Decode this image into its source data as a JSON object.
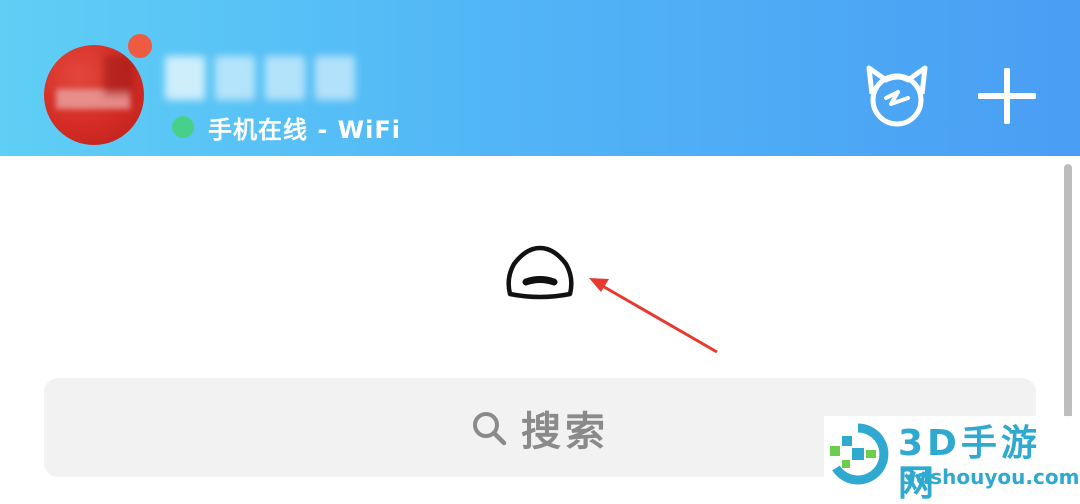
{
  "header": {
    "status_text": "手机在线 - WiFi",
    "accent": "#52b6f6",
    "status_color": "#47d08a",
    "notification_color": "#ee5a42"
  },
  "icons": {
    "avatar": "avatar",
    "pet": "cat-face-icon",
    "add": "plus-icon",
    "collapse": "collapse-handle-icon",
    "search": "search-icon"
  },
  "search": {
    "label": "搜索"
  },
  "annotation": {
    "arrow_color": "#e8392f"
  },
  "watermark": {
    "title": "3D手游网",
    "url": "3dshouyou.com",
    "color": "#2fa9d0"
  }
}
